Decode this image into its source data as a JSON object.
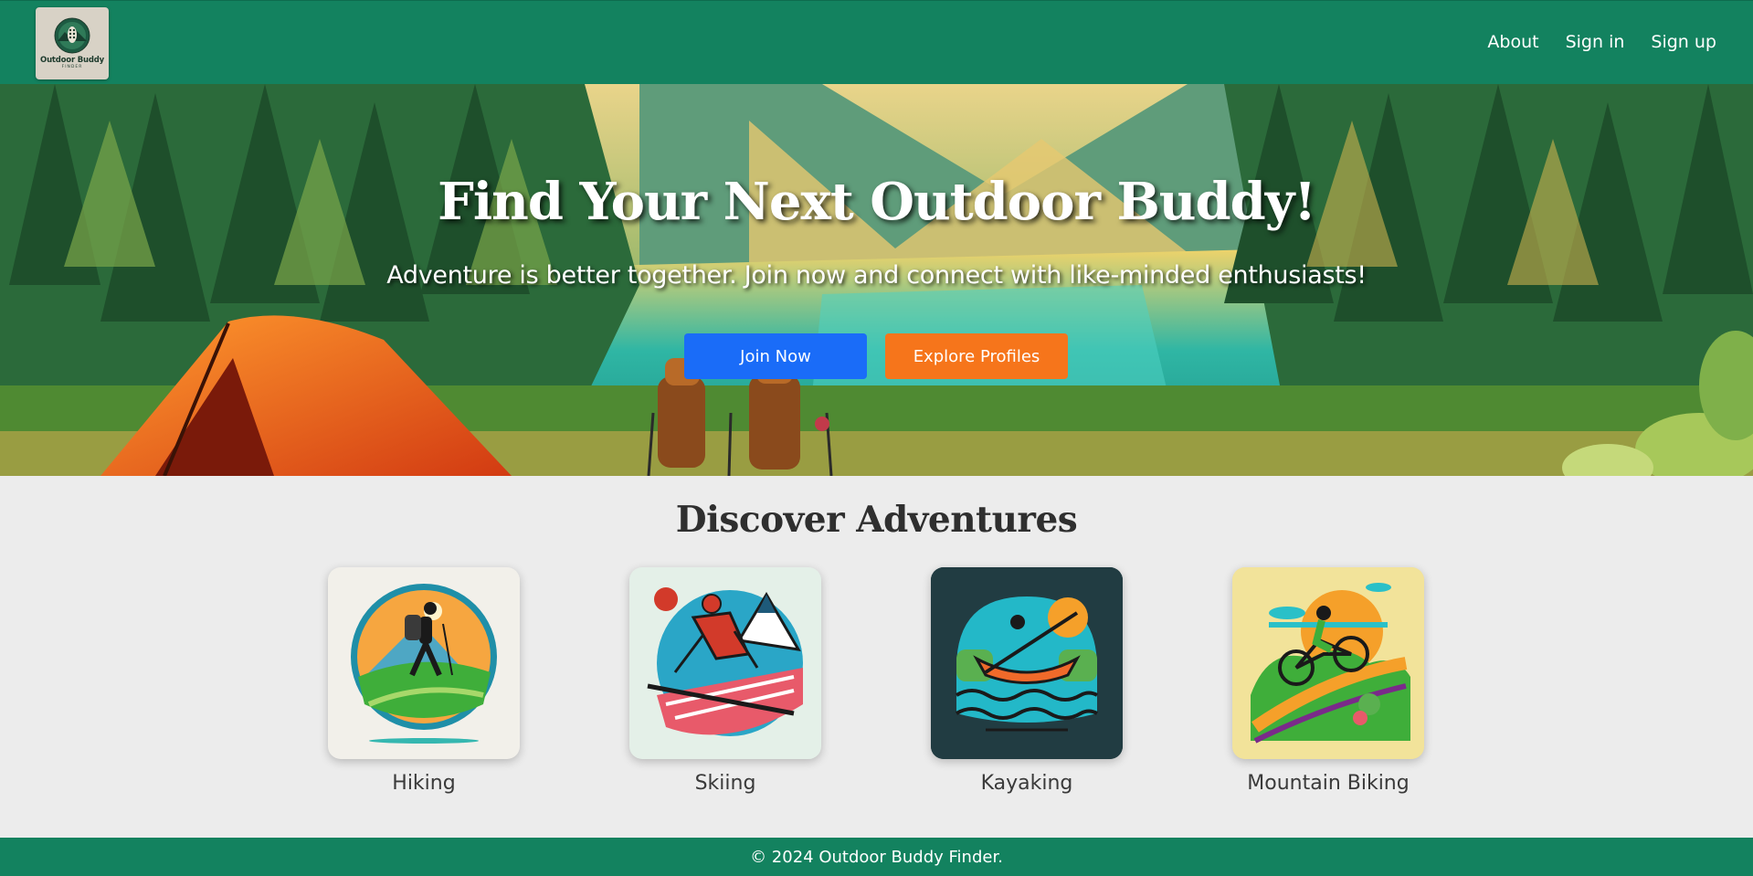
{
  "header": {
    "logo": {
      "name": "Outdoor Buddy",
      "sub": "FINDER",
      "icon": "boot-print-icon"
    },
    "nav": [
      {
        "label": "About"
      },
      {
        "label": "Sign in"
      },
      {
        "label": "Sign up"
      }
    ],
    "bg_color": "#13825f"
  },
  "hero": {
    "title": "Find Your Next Outdoor Buddy!",
    "subtitle": "Adventure is better together. Join now and connect with like-minded enthusiasts!",
    "buttons": {
      "join": {
        "label": "Join Now",
        "color": "#1a6cf8"
      },
      "explore": {
        "label": "Explore Profiles",
        "color": "#f6751b"
      }
    }
  },
  "discover": {
    "title": "Discover Adventures",
    "activities": [
      {
        "label": "Hiking",
        "icon": "hiking-icon"
      },
      {
        "label": "Skiing",
        "icon": "skiing-icon"
      },
      {
        "label": "Kayaking",
        "icon": "kayaking-icon"
      },
      {
        "label": "Mountain Biking",
        "icon": "mountain-biking-icon"
      }
    ]
  },
  "footer": {
    "text": "© 2024 Outdoor Buddy Finder."
  }
}
